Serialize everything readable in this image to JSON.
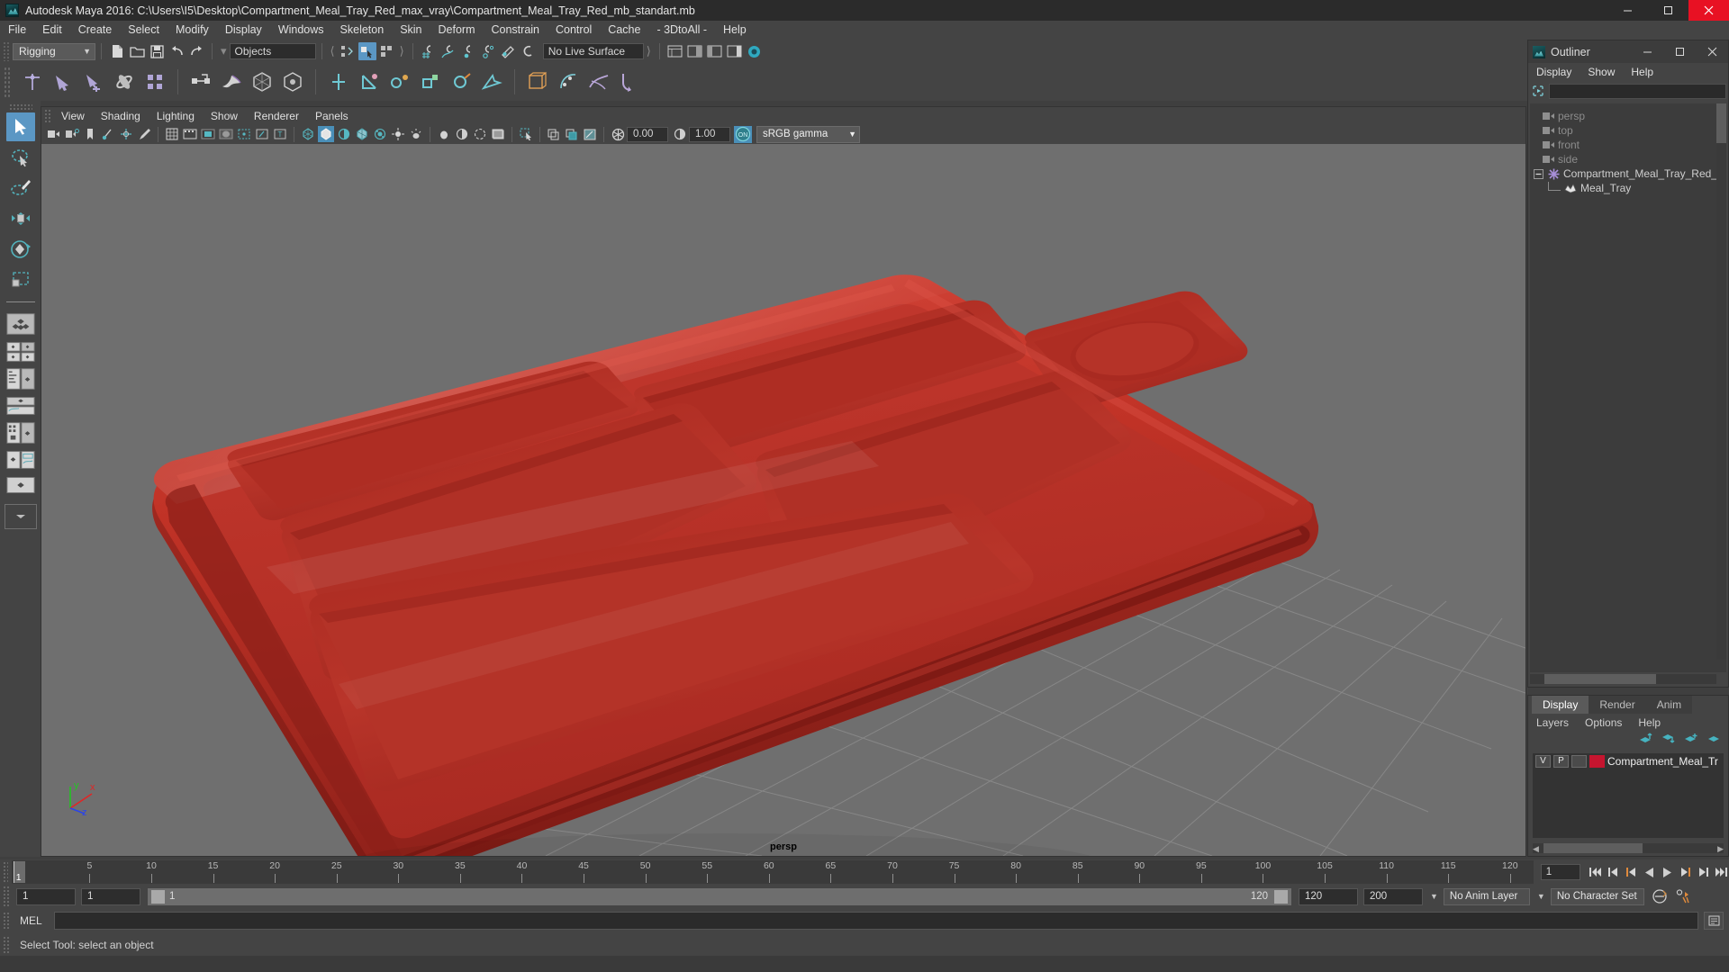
{
  "window": {
    "title": "Autodesk Maya 2016: C:\\Users\\I5\\Desktop\\Compartment_Meal_Tray_Red_max_vray\\Compartment_Meal_Tray_Red_mb_standart.mb",
    "app_icon": "maya-logo-icon",
    "minimize": "minimize-icon",
    "maximize": "maximize-icon",
    "close": "close-icon"
  },
  "menubar": {
    "items": [
      "File",
      "Edit",
      "Create",
      "Select",
      "Modify",
      "Display",
      "Windows",
      "Skeleton",
      "Skin",
      "Deform",
      "Constrain",
      "Control",
      "Cache",
      "- 3DtoAll -",
      "Help"
    ]
  },
  "statusbar": {
    "menuset": "Rigging",
    "selection_mask": "Objects",
    "live_surface": "No Live Surface",
    "icons": [
      "new-scene-icon",
      "open-scene-icon",
      "save-scene-icon",
      "undo-icon",
      "redo-icon",
      "select-by-hierarchy-icon",
      "select-by-object-icon",
      "select-by-component-icon",
      "snap-to-grid-icon",
      "snap-to-curve-icon",
      "snap-to-point-icon",
      "snap-to-projected-center-icon",
      "snap-to-view-plane-icon",
      "make-live-icon",
      "show-hide-editors-icon",
      "attribute-editor-icon",
      "tool-settings-icon",
      "channel-box-icon",
      "render-view-icon"
    ]
  },
  "shelf": {
    "icons": [
      "joint-tool-icon",
      "ik-handle-tool-icon",
      "ik-spline-handle-icon",
      "insert-joint-tool-icon",
      "mirror-joint-icon",
      "bind-skin-icon",
      "interactive-bind-icon",
      "smooth-bind-icon",
      "detach-skin-icon",
      "paint-weights-icon",
      "copy-weights-icon",
      "mirror-weights-icon",
      "parent-constraint-icon",
      "point-constraint-icon",
      "orient-constraint-icon",
      "scale-constraint-icon",
      "aim-constraint-icon",
      "pole-vector-icon",
      "lattice-icon",
      "cluster-icon",
      "wire-tool-icon",
      "wrap-deformer-icon"
    ]
  },
  "toolbox": {
    "tools": [
      "select-tool",
      "lasso-select-tool",
      "paint-select-tool",
      "move-tool",
      "rotate-tool",
      "scale-tool"
    ],
    "selected": "select-tool",
    "layouts": [
      "single-perspective-layout",
      "four-view-layout",
      "two-pane-stacked-layout",
      "outliner-persp-layout",
      "persp-graph-layout",
      "hypershade-persp-layout",
      "persp-hypergraph-layout",
      "persp-outliner-graph-layout",
      "layout-dropdown"
    ]
  },
  "viewport": {
    "panel_menu": [
      "View",
      "Shading",
      "Lighting",
      "Show",
      "Renderer",
      "Panels"
    ],
    "camera_label": "persp",
    "exposure_value": "0.00",
    "gamma_value": "1.00",
    "color_management": "sRGB gamma",
    "color_management_toggle": "ON",
    "toolbar_icons": [
      "select-camera-icon",
      "camera-attributes-icon",
      "bookmark-icon",
      "image-plane-icon",
      "two-d-pan-zoom-icon",
      "grease-pencil-icon",
      "grid-icon",
      "film-gate-icon",
      "resolution-gate-icon",
      "gate-mask-icon",
      "film-origin-icon",
      "safe-action-icon",
      "safe-title-icon",
      "wireframe-icon",
      "smooth-shade-icon",
      "shade-all-icon",
      "wireframe-on-shaded-icon",
      "xray-icon",
      "xray-joints-icon",
      "lights-default-icon",
      "lights-all-icon",
      "shadows-icon",
      "screen-space-ao-icon",
      "motion-blur-icon",
      "multisample-icon",
      "viewport-renderer-icon",
      "isolate-select-icon",
      "texture-icon",
      "hardware-texturing-icon",
      "high-quality-icon",
      "exposure-icon",
      "gamma-icon",
      "color-management-icon"
    ],
    "grid": {
      "visible": true,
      "color": "#8a8a8a"
    },
    "background_color": "#6f6f6f",
    "model": {
      "name": "Compartment Meal Tray Red",
      "color": "#c0352e"
    },
    "axis": {
      "x": "x",
      "y": "y",
      "z": "z"
    }
  },
  "outliner": {
    "title": "Outliner",
    "icon": "maya-logo-icon",
    "menus": [
      "Display",
      "Show",
      "Help"
    ],
    "search_value": "",
    "items": [
      {
        "label": "persp",
        "icon": "camera-icon",
        "dim": true,
        "indent": 0,
        "expandable": false
      },
      {
        "label": "top",
        "icon": "camera-icon",
        "dim": true,
        "indent": 0,
        "expandable": false
      },
      {
        "label": "front",
        "icon": "camera-icon",
        "dim": true,
        "indent": 0,
        "expandable": false
      },
      {
        "label": "side",
        "icon": "camera-icon",
        "dim": true,
        "indent": 0,
        "expandable": false
      },
      {
        "label": "Compartment_Meal_Tray_Red_",
        "icon": "transform-icon",
        "dim": false,
        "indent": 0,
        "expandable": true
      },
      {
        "label": "Meal_Tray",
        "icon": "mesh-icon",
        "dim": false,
        "indent": 1,
        "expandable": false
      }
    ],
    "window_buttons": [
      "minimize-icon",
      "maximize-icon",
      "close-icon"
    ]
  },
  "layer_editor": {
    "tabs": [
      "Display",
      "Render",
      "Anim"
    ],
    "active_tab": "Display",
    "menus": [
      "Layers",
      "Options",
      "Help"
    ],
    "toolbar_icons": [
      "move-layer-up-icon",
      "move-layer-down-icon",
      "new-layer-icon",
      "new-layer-from-selected-icon"
    ],
    "layers": [
      {
        "visibility": "V",
        "playback": "P",
        "type": "",
        "color": "#c5152f",
        "name": "Compartment_Meal_Tr"
      }
    ]
  },
  "timeline": {
    "ticks": [
      5,
      10,
      15,
      20,
      25,
      30,
      35,
      40,
      45,
      50,
      55,
      60,
      65,
      70,
      75,
      80,
      85,
      90,
      95,
      100,
      105,
      110,
      115,
      120
    ],
    "current_frame": "1",
    "current_frame_field": "1",
    "playback_buttons": [
      "go-to-start-icon",
      "step-back-keyframe-icon",
      "step-back-frame-icon",
      "play-backwards-icon",
      "play-forwards-icon",
      "step-forward-frame-icon",
      "step-forward-keyframe-icon",
      "go-to-end-icon"
    ]
  },
  "range": {
    "anim_start": "1",
    "range_start": "1",
    "slider_label": "1",
    "slider_end_label": "120",
    "range_end": "120",
    "anim_end": "200",
    "anim_layer": "No Anim Layer",
    "character_set": "No Character Set",
    "auto_key_icon": "auto-keyframe-icon",
    "anim_prefs_icon": "animation-preferences-icon"
  },
  "command_line": {
    "language": "MEL",
    "value": "",
    "script_editor_icon": "script-editor-icon"
  },
  "help_line": {
    "text": "Select Tool: select an object"
  }
}
